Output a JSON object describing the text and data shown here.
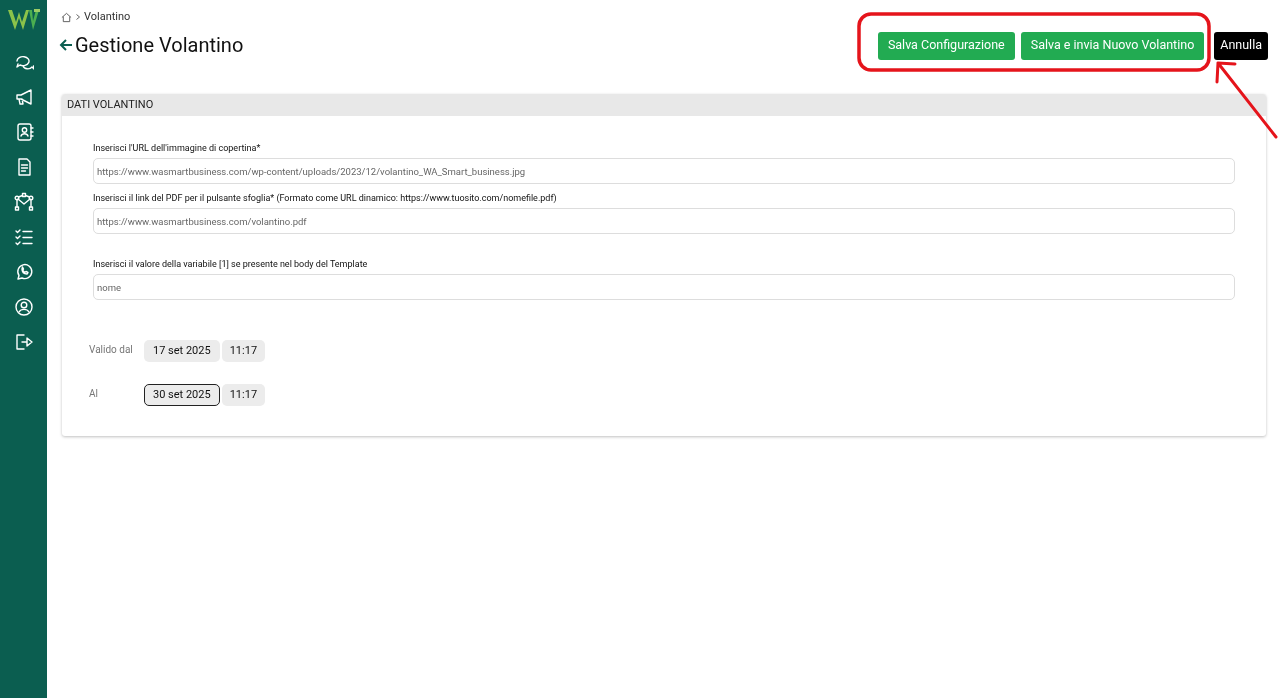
{
  "breadcrumb": {
    "current": "Volantino"
  },
  "page_title": "Gestione Volantino",
  "actions": [
    {
      "label": "Salva Configurazione",
      "kind": "primary"
    },
    {
      "label": "Salva e invia Nuovo Volantino",
      "kind": "primary"
    },
    {
      "label": "Annulla",
      "kind": "dark"
    }
  ],
  "panel": {
    "title": "DATI VOLANTINO",
    "fields": [
      {
        "label": "Inserisci l'URL dell'immagine di copertina*",
        "value": "https://www.wasmartbusiness.com/wp-content/uploads/2023/12/volantino_WA_Smart_business.jpg"
      },
      {
        "label": "Inserisci il link del PDF per il pulsante sfoglia* (Formato come URL dinamico: https://www.tuosito.com/nomefile.pdf)",
        "value": "https://www.wasmartbusiness.com/volantino.pdf"
      },
      {
        "label": "Inserisci il valore della variabile [1] se presente nel body del Template",
        "value": "nome"
      }
    ],
    "dates": [
      {
        "label": "Valido dal",
        "date": "17 set 2025",
        "time": "11:17",
        "focused": false
      },
      {
        "label": "Al",
        "date": "30 set 2025",
        "time": "11:17",
        "focused": true
      }
    ]
  }
}
